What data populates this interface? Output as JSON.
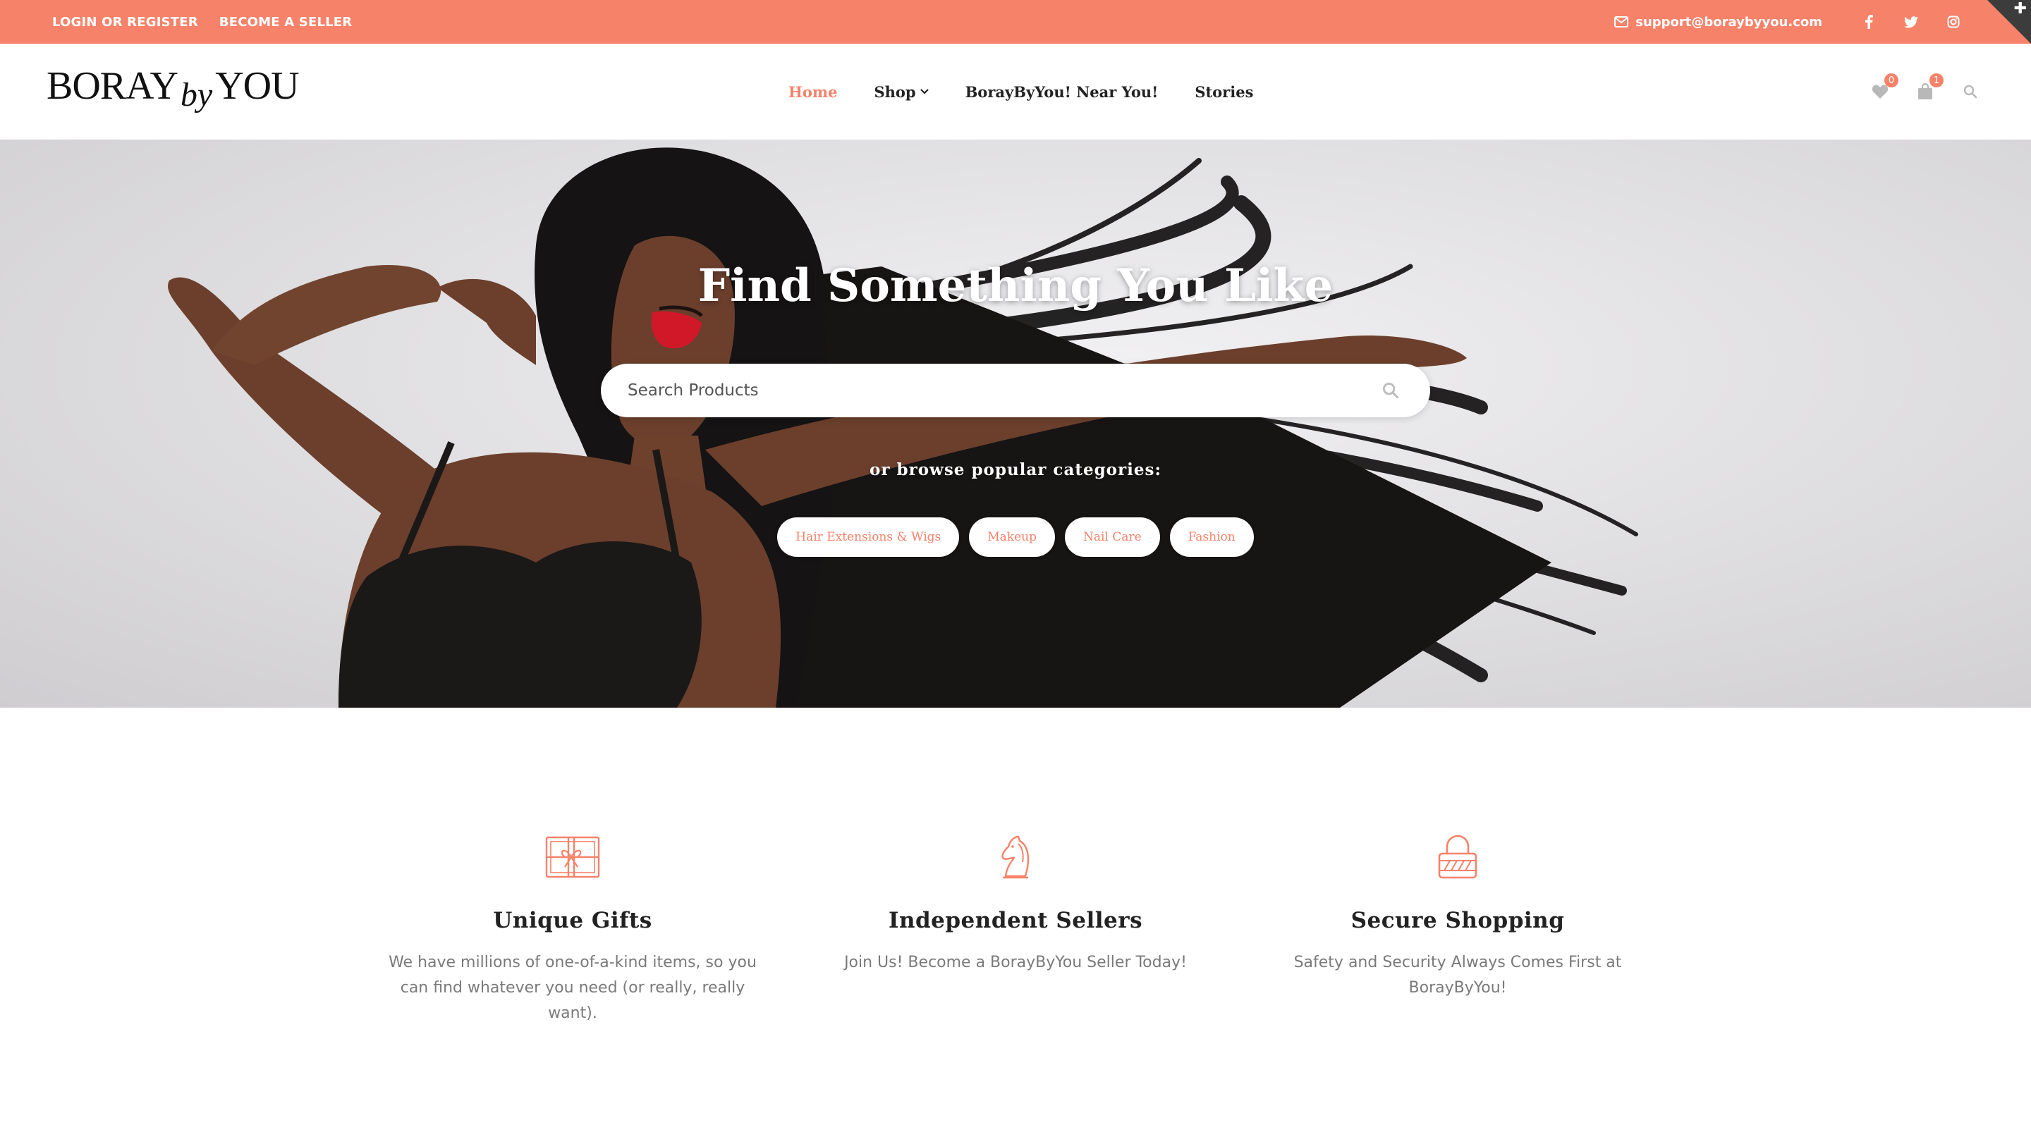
{
  "colors": {
    "accent": "#f6826a",
    "dark": "#222222",
    "muted": "#7a7a7a"
  },
  "topbar": {
    "login": "LOGIN OR REGISTER",
    "seller": "BECOME A SELLER",
    "email": "support@boraybyyou.com",
    "social": [
      "facebook-icon",
      "twitter-icon",
      "instagram-icon"
    ]
  },
  "logo": {
    "part1": "BORAY",
    "part2": "by",
    "part3": "YOU"
  },
  "nav": {
    "home": "Home",
    "shop": "Shop",
    "near": "BorayByYou! Near You!",
    "stories": "Stories"
  },
  "header_icons": {
    "wishlist_count": "0",
    "cart_count": "1"
  },
  "hero": {
    "title": "Find Something You Like",
    "search_placeholder": "Search Products",
    "browse_label": "or browse popular categories:",
    "categories": [
      "Hair Extensions & Wigs",
      "Makeup",
      "Nail Care",
      "Fashion"
    ]
  },
  "features": [
    {
      "icon": "gift-card-icon",
      "title": "Unique Gifts",
      "text": "We have millions of one-of-a-kind items, so you can find whatever you need (or really, really want)."
    },
    {
      "icon": "chess-knight-icon",
      "title": "Independent Sellers",
      "text": "Join Us! Become a BorayByYou Seller Today!"
    },
    {
      "icon": "lock-icon",
      "title": "Secure Shopping",
      "text": "Safety and Security Always Comes First at BorayByYou!"
    }
  ]
}
